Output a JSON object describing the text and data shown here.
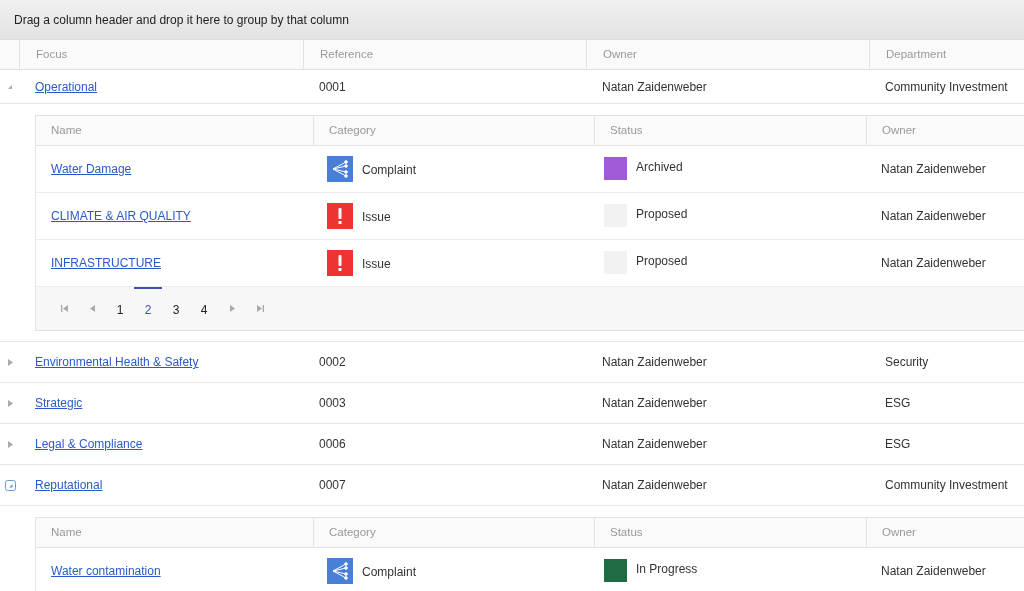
{
  "group_panel": {
    "hint": "Drag a column header and drop it here to group by that column"
  },
  "columns": [
    "Focus",
    "Reference",
    "Owner",
    "Department"
  ],
  "groups": [
    {
      "focus": "Operational",
      "reference": "0001",
      "owner": "Natan Zaidenweber",
      "department": "Community Investment",
      "expanded": true,
      "focused": false,
      "details": {
        "columns": [
          "Name",
          "Category",
          "Status",
          "Owner"
        ],
        "rows": [
          {
            "name": "Water Damage",
            "category": "Complaint",
            "kind": "complaint",
            "status": "Archived",
            "color": "#a05ad8",
            "owner": "Natan Zaidenweber"
          },
          {
            "name": "CLIMATE & AIR QUALITY",
            "category": "Issue",
            "kind": "issue",
            "status": "Proposed",
            "color": "#f2f2f2",
            "owner": "Natan Zaidenweber"
          },
          {
            "name": "INFRASTRUCTURE",
            "category": "Issue",
            "kind": "issue",
            "status": "Proposed",
            "color": "#f2f2f2",
            "owner": "Natan Zaidenweber"
          }
        ],
        "pager": {
          "pages": [
            {
              "label": "1",
              "selected": false
            },
            {
              "label": "2",
              "selected": true
            },
            {
              "label": "3",
              "selected": false
            },
            {
              "label": "4",
              "selected": false
            }
          ]
        }
      }
    },
    {
      "focus": "Environmental Health & Safety",
      "reference": "0002",
      "owner": "Natan Zaidenweber",
      "department": "Security",
      "expanded": false,
      "focused": false
    },
    {
      "focus": "Strategic",
      "reference": "0003",
      "owner": "Natan Zaidenweber",
      "department": "ESG",
      "expanded": false,
      "focused": false
    },
    {
      "focus": "Legal & Compliance",
      "reference": "0006",
      "owner": "Natan Zaidenweber",
      "department": "ESG",
      "expanded": false,
      "focused": false
    },
    {
      "focus": "Reputational",
      "reference": "0007",
      "owner": "Natan Zaidenweber",
      "department": "Community Investment",
      "expanded": true,
      "focused": true,
      "details": {
        "columns": [
          "Name",
          "Category",
          "Status",
          "Owner"
        ],
        "rows": [
          {
            "name": "Water contamination",
            "category": "Complaint",
            "kind": "complaint",
            "status": "In Progress",
            "color": "#1f6b44",
            "owner": "Natan Zaidenweber"
          }
        ]
      }
    }
  ]
}
